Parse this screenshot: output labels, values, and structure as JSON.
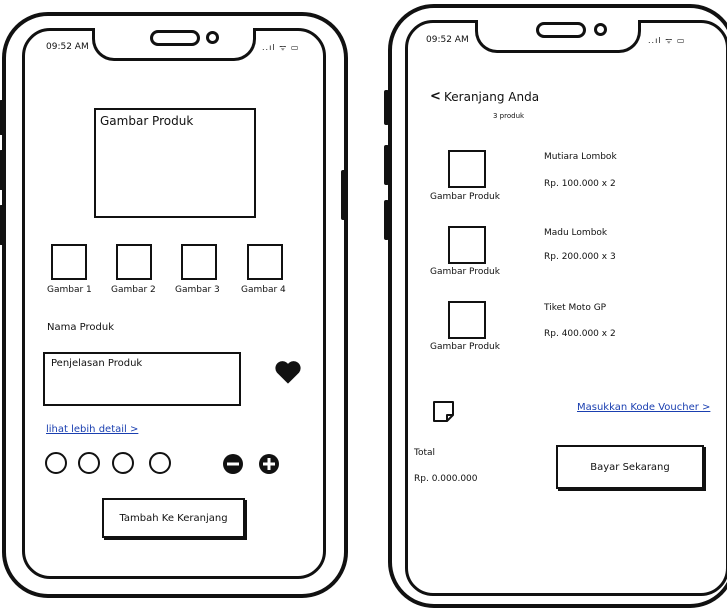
{
  "left": {
    "status_time": "09:52 AM",
    "status_icons": "..ıl ᯤ ▭",
    "main_image_label": "Gambar Produk",
    "thumbnails": [
      "Gambar 1",
      "Gambar 2",
      "Gambar 3",
      "Gambar 4"
    ],
    "product_name": "Nama Produk",
    "description": "Penjelasan Produk",
    "detail_link": "lihat lebih detail >",
    "add_to_cart": "Tambah Ke Keranjang"
  },
  "right": {
    "status_time": "09:52 AM",
    "status_icons": "..ıl ᯤ ▭",
    "back_symbol": "<",
    "title": "Keranjang Anda",
    "count": "3 produk",
    "items": [
      {
        "image_label": "Gambar Produk",
        "name": "Mutiara Lombok",
        "price": "Rp. 100.000 x 2"
      },
      {
        "image_label": "Gambar Produk",
        "name": "Madu Lombok",
        "price": "Rp. 200.000 x 3"
      },
      {
        "image_label": "Gambar Produk",
        "name": "Tiket Moto GP",
        "price": "Rp. 400.000 x 2"
      }
    ],
    "voucher_link": "Masukkan Kode Voucher >",
    "total_label": "Total",
    "total_value": "Rp. 0.000.000",
    "pay_button": "Bayar Sekarang"
  }
}
